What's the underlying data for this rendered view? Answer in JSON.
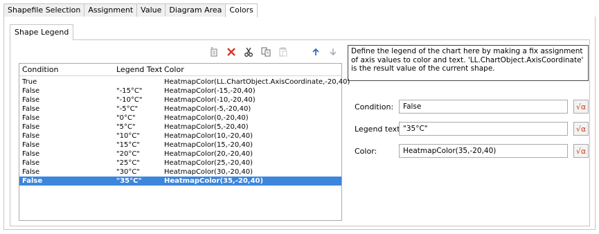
{
  "tabs": [
    {
      "label": "Shapefile Selection"
    },
    {
      "label": "Assignment"
    },
    {
      "label": "Value"
    },
    {
      "label": "Diagram Area"
    },
    {
      "label": "Colors"
    }
  ],
  "subtab": {
    "label": "Shape Legend"
  },
  "toolbar": {
    "new_icon": "new-document-icon",
    "delete_icon": "delete-x-icon",
    "cut_icon": "scissors-icon",
    "copy_icon": "copy-icon",
    "paste_icon": "paste-icon",
    "up_icon": "arrow-up-icon",
    "down_icon": "arrow-down-icon",
    "delete_color": "#d9362b",
    "arrow_color": "#2a6fcf"
  },
  "grid": {
    "columns": [
      "Condition",
      "Legend Text",
      "Color"
    ],
    "rows": [
      {
        "condition": "True",
        "legend": "",
        "color": "HeatmapColor(LL.ChartObject.AxisCoordinate,-20,40)"
      },
      {
        "condition": "False",
        "legend": "\"-15°C\"",
        "color": "HeatmapColor(-15,-20,40)"
      },
      {
        "condition": "False",
        "legend": "\"-10°C\"",
        "color": "HeatmapColor(-10,-20,40)"
      },
      {
        "condition": "False",
        "legend": "\"-5°C\"",
        "color": "HeatmapColor(-5,-20,40)"
      },
      {
        "condition": "False",
        "legend": "\"0°C\"",
        "color": "HeatmapColor(0,-20,40)"
      },
      {
        "condition": "False",
        "legend": "\"5°C\"",
        "color": "HeatmapColor(5,-20,40)"
      },
      {
        "condition": "False",
        "legend": "\"10°C\"",
        "color": "HeatmapColor(10,-20,40)"
      },
      {
        "condition": "False",
        "legend": "\"15°C\"",
        "color": "HeatmapColor(15,-20,40)"
      },
      {
        "condition": "False",
        "legend": "\"20°C\"",
        "color": "HeatmapColor(20,-20,40)"
      },
      {
        "condition": "False",
        "legend": "\"25°C\"",
        "color": "HeatmapColor(25,-20,40)"
      },
      {
        "condition": "False",
        "legend": "\"30°C\"",
        "color": "HeatmapColor(30,-20,40)"
      },
      {
        "condition": "False",
        "legend": "\"35°C\"",
        "color": "HeatmapColor(35,-20,40)"
      }
    ],
    "selected_row": 11,
    "selection_color": "#3c86dc"
  },
  "description": "Define the legend of the chart here by making a fix assignment of axis values to color and text. 'LL.ChartObject.AxisCoordinate' is the result value of the current shape.",
  "fields": {
    "condition": {
      "label": "Condition:",
      "value": "False"
    },
    "legend_text": {
      "label": "Legend text:",
      "value": "\"35°C\""
    },
    "color": {
      "label": "Color:",
      "value": "HeatmapColor(35,-20,40)"
    },
    "formula_button_label": "√α"
  }
}
